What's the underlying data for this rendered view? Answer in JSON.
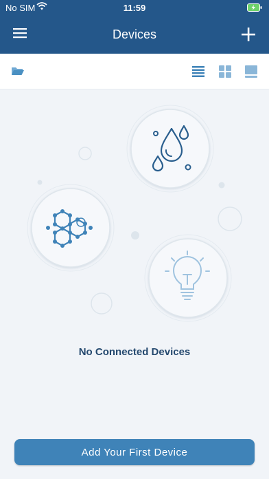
{
  "status_bar": {
    "carrier": "No SIM",
    "time": "11:59"
  },
  "header": {
    "title": "Devices",
    "menu_icon": "hamburger-menu-icon",
    "add_icon": "plus-icon"
  },
  "toolbar": {
    "folder_icon": "folder-icon",
    "view_modes": [
      "list-view-icon",
      "grid-view-icon",
      "card-view-icon"
    ]
  },
  "illustration": {
    "icons": [
      "water-drops-icon",
      "molecule-icon",
      "light-bulb-icon"
    ]
  },
  "empty_state": {
    "message": "No Connected Devices"
  },
  "actions": {
    "add_first_device": "Add Your First Device"
  },
  "colors": {
    "header_bg": "#24578a",
    "button_bg": "#3f83b8",
    "icon_accent": "#4a90c2",
    "text_dark": "#24486e"
  }
}
